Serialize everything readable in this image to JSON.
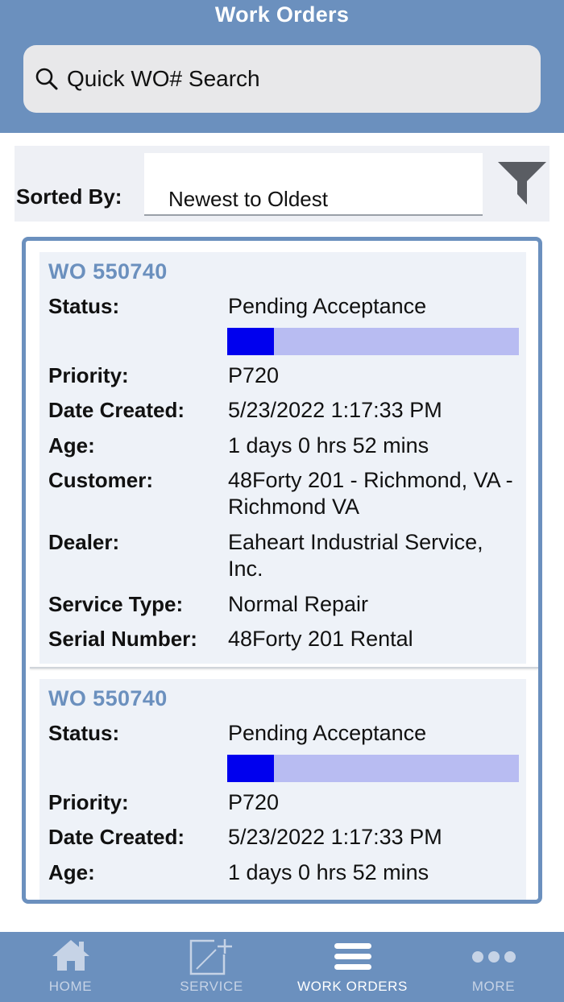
{
  "header": {
    "title": "Work Orders"
  },
  "search": {
    "placeholder": "Quick WO# Search",
    "icon": "search-icon"
  },
  "sort": {
    "label": "Sorted By:",
    "value": "Newest to Oldest",
    "filter_icon": "filter-icon"
  },
  "labels": {
    "status": "Status:",
    "priority": "Priority:",
    "date_created": "Date Created:",
    "age": "Age:",
    "customer": "Customer:",
    "dealer": "Dealer:",
    "service_type": "Service Type:",
    "serial_number": "Serial Number:"
  },
  "work_orders": [
    {
      "title": "WO 550740",
      "status": "Pending Acceptance",
      "progress": 0.16,
      "priority": "P720",
      "date_created": "5/23/2022 1:17:33 PM",
      "age": "1 days 0 hrs 52 mins",
      "customer": "48Forty 201 - Richmond, VA - Richmond VA",
      "dealer": "Eaheart Industrial Service, Inc.",
      "service_type": "Normal Repair",
      "serial_number": "48Forty 201 Rental"
    },
    {
      "title": "WO 550740",
      "status": "Pending Acceptance",
      "progress": 0.16,
      "priority": "P720",
      "date_created": "5/23/2022 1:17:33 PM",
      "age": "1 days 0 hrs 52 mins"
    }
  ],
  "colors": {
    "accent": "#6b90be",
    "progress_fill": "#0000ee",
    "progress_track": "#b8bcf2",
    "card_bg": "#eef2f8"
  },
  "tabs": [
    {
      "label": "HOME",
      "icon": "home-icon",
      "active": false
    },
    {
      "label": "SERVICE",
      "icon": "add-service-icon",
      "active": false
    },
    {
      "label": "WORK ORDERS",
      "icon": "list-icon",
      "active": true
    },
    {
      "label": "MORE",
      "icon": "more-icon",
      "active": false
    }
  ]
}
